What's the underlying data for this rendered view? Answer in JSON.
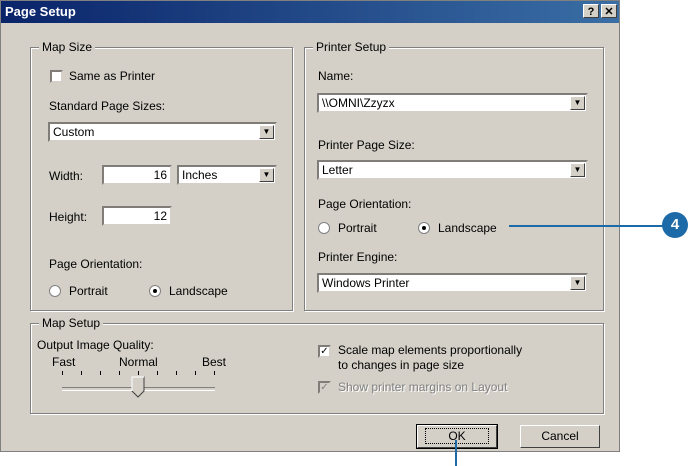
{
  "window": {
    "title": "Page Setup",
    "help_glyph": "?",
    "close_glyph": "✕"
  },
  "map_size": {
    "legend": "Map Size",
    "same_as_printer": {
      "label": "Same as Printer",
      "checked": false
    },
    "standard_label": "Standard Page Sizes:",
    "standard_value": "Custom",
    "width_label": "Width:",
    "width_value": "16",
    "units_value": "Inches",
    "height_label": "Height:",
    "height_value": "12",
    "orientation_label": "Page Orientation:",
    "portrait_label": "Portrait",
    "landscape_label": "Landscape",
    "orientation_selected": "Landscape"
  },
  "printer_setup": {
    "legend": "Printer Setup",
    "name_label": "Name:",
    "name_value": "\\\\OMNI\\Zzyzx",
    "page_size_label": "Printer Page Size:",
    "page_size_value": "Letter",
    "orientation_label": "Page Orientation:",
    "portrait_label": "Portrait",
    "landscape_label": "Landscape",
    "orientation_selected": "Landscape",
    "engine_label": "Printer Engine:",
    "engine_value": "Windows Printer"
  },
  "map_setup": {
    "legend": "Map Setup",
    "quality_label": "Output Image Quality:",
    "fast_label": "Fast",
    "normal_label": "Normal",
    "best_label": "Best",
    "quality_level": "Normal",
    "scale_label_line1": "Scale map elements proportionally",
    "scale_label_line2": "to changes in page size",
    "scale_checked": true,
    "margins_label": "Show printer margins on Layout",
    "margins_checked": true,
    "margins_disabled": true
  },
  "buttons": {
    "ok": "OK",
    "cancel": "Cancel"
  },
  "callout": {
    "number": "4",
    "color": "#1d6aa8"
  }
}
